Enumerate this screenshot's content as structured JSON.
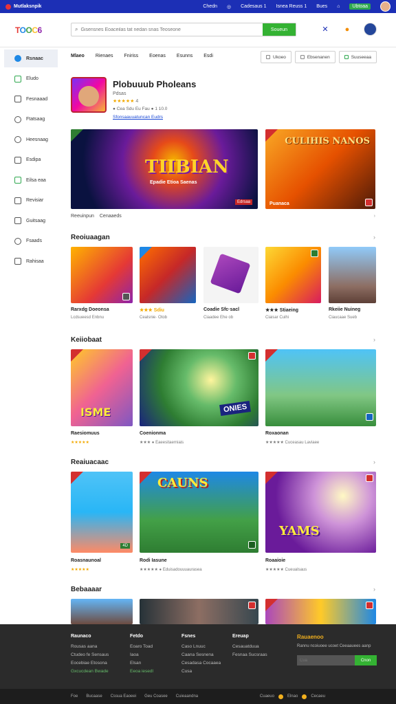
{
  "topbar": {
    "brand": "Mutlaksnpik",
    "links": [
      "Chedn",
      "Cadesaus 1",
      "Isnea Reuss 1",
      "Bues"
    ],
    "green_link": "Ubtoaa"
  },
  "header": {
    "logo_letters": [
      "T",
      "O",
      "O",
      "C",
      "6"
    ],
    "search_placeholder": "Gisensnes Eoaceilas tat nedan snas Teoseone",
    "search_button": "Soueun"
  },
  "sidebar": {
    "items": [
      {
        "label": "Rsnaac",
        "icon": "home-icon"
      },
      {
        "label": "Eludo",
        "icon": "house-icon"
      },
      {
        "label": "Fesnaaad",
        "icon": "folder-icon"
      },
      {
        "label": "Ftatsaag",
        "icon": "clock-icon"
      },
      {
        "label": "Heesnaag",
        "icon": "chat-icon"
      },
      {
        "label": "Esdipa",
        "icon": "bag-icon"
      },
      {
        "label": "Eilsa eaa",
        "icon": "store-icon"
      },
      {
        "label": "Revisiar",
        "icon": "mail-icon"
      },
      {
        "label": "Guitsaag",
        "icon": "grid-icon"
      },
      {
        "label": "Fsaads",
        "icon": "settings-icon"
      },
      {
        "label": "Rahisaa",
        "icon": "card-icon"
      }
    ]
  },
  "navtabs": [
    "Mlaeo",
    "Rienaes",
    "Fniriss",
    "Eoenas",
    "Esunns",
    "Esdi"
  ],
  "navbuttons": [
    "Ukoeo",
    "Ebsenanen",
    "Suuseeaa"
  ],
  "profile": {
    "title": "Plobuuub Pholeans",
    "sub": "Pdsas",
    "stars": "★★★★★",
    "rating": "4",
    "meta": "● Cea Sdu Eu Fau ● 1 10.0",
    "link": "Sfonsaauuatuncan Eudrs"
  },
  "banner1": {
    "title": "TIIBIAN",
    "subtitle": "Epadie Etioa Saenas",
    "tag": "Edrsaa"
  },
  "banner2": {
    "title": "CULIHIS NANOS",
    "caption": "Puanaca"
  },
  "row_info": {
    "a": "Reeuinpun",
    "b": "Cenaaeds"
  },
  "sections": [
    {
      "title": "Reoiuaagan"
    },
    {
      "title": "Keiiobaat"
    },
    {
      "title": "Reaiuacaac"
    },
    {
      "title": "Bebaaaar"
    }
  ],
  "row1": [
    {
      "title": "Rarxdg Doeonsa",
      "sub": "Lcdsueesd Enbnu"
    },
    {
      "title": "★★★ Sdiu",
      "sub": "Cealsnie· Otob"
    },
    {
      "title": "Coadie Sfc·sacl",
      "sub": "Ciaadee Ehe ob"
    },
    {
      "title": "★★★ Stiaeing",
      "sub": "Ciaisar Cuihi"
    },
    {
      "title": "Rkeiie Nuineg",
      "sub": "Ciaucaae Sueb"
    }
  ],
  "row2": [
    {
      "title": "Raesiomuus",
      "sub": "★★★★★",
      "badge": "ISME"
    },
    {
      "title": "Coenionma",
      "sub": "★★★ ● Eaeesitaerniais",
      "badge": "ONIES"
    },
    {
      "title": "Roxaonan",
      "sub": "★★★★★ Cuceasau Laviaee"
    }
  ],
  "row3": [
    {
      "title": "Roasnaunoal",
      "sub": "★★★★★"
    },
    {
      "title": "Rodi Iasune",
      "sub": "★★★★★ ● Eduisadouuuaurasea",
      "badge": "CAUNS"
    },
    {
      "title": "Roaaioie",
      "sub": "★★★★★ Cueualsaus",
      "badge": "YAMS"
    }
  ],
  "footer": {
    "cols": [
      {
        "h": "Raunaco",
        "items": [
          "Rousas aana",
          "Ctudeo fe Sensaus",
          "Eocebiae Etosona",
          "Gxcucdean Bwade"
        ]
      },
      {
        "h": "Fetdo",
        "items": [
          "Eoaro Toad",
          "Iaoa",
          "Elsan",
          "Eeoa iesedl"
        ]
      },
      {
        "h": "Fsnes",
        "items": [
          "Caso Lnuuc",
          "Caana Sesnena",
          "Cesadasa Cocaaea",
          "Cusa"
        ]
      },
      {
        "h": "Ereuap",
        "items": [
          "Cesauatduua",
          "Fesnaa Sucsraas"
        ]
      }
    ],
    "newsletter": {
      "title": "Rauaenoo",
      "text": "Rannu ncoiuoee ucoet Ceeaauees aanp",
      "placeholder": "Cua",
      "button": "Cnon"
    }
  },
  "bottombar": {
    "links": [
      "Foe",
      "Bucaase",
      "Cssua Eaoeei",
      "Geu Coasee",
      "Cuieaandna"
    ],
    "right": [
      "Cuaeuo",
      "Elnao",
      "Cecaeu"
    ]
  }
}
